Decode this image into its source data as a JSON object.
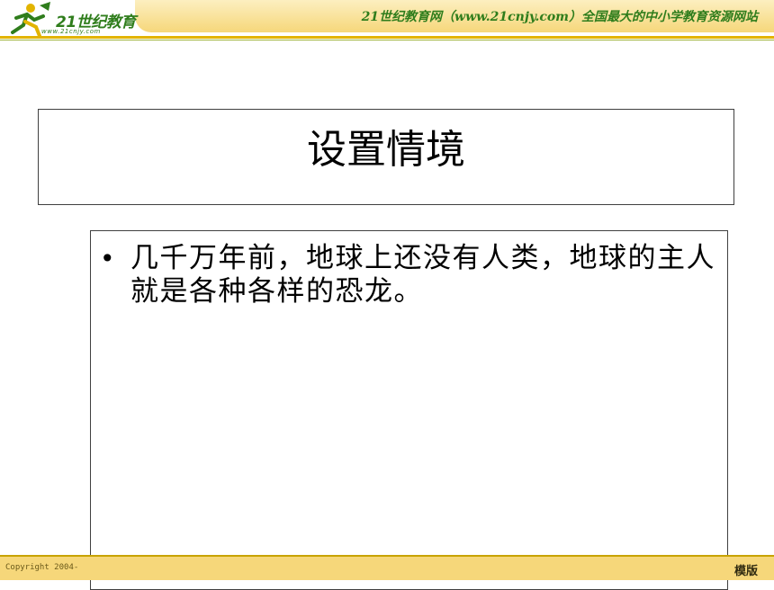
{
  "header": {
    "logo_text": "21世纪教育",
    "logo_url": "www.21cnjy.com",
    "site_banner": "21世纪教育网（www.21cnjy.com）全国最大的中小学教育资源网站"
  },
  "slide": {
    "title": "设置情境",
    "bullets": [
      "几千万年前，地球上还没有人类，地球的主人就是各种各样的恐龙。"
    ]
  },
  "footer": {
    "copyright": "Copyright 2004-",
    "edition": "模版"
  },
  "colors": {
    "band": "#f6d77a",
    "brand_green": "#2f7d1c",
    "accent_gold": "#e2b400"
  }
}
